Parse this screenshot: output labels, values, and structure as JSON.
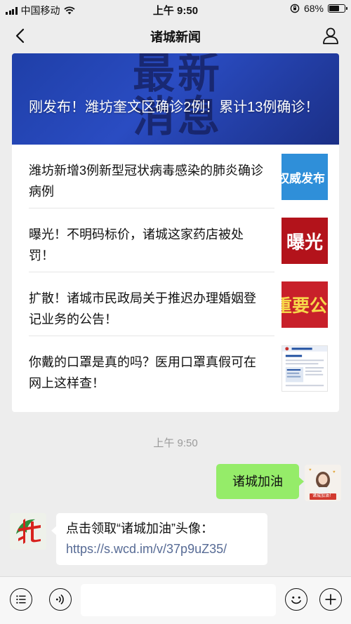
{
  "status_bar": {
    "carrier": "中国移动",
    "time": "上午 9:50",
    "battery_text": "68%",
    "battery_level": 0.68
  },
  "nav": {
    "title": "诸城新闻",
    "back_icon": "chevron-left-icon",
    "profile_icon": "person-icon"
  },
  "article_card": {
    "hero": {
      "title": "刚发布！潍坊奎文区确诊2例！累计13例确诊！",
      "background_text": "最新消息"
    },
    "items": [
      {
        "title": "潍坊新增3例新型冠状病毒感染的肺炎确诊病例",
        "thumb_text": "权威发布",
        "thumb_bg": "#2f8fd9",
        "thumb_color": "#ffffff"
      },
      {
        "title": "曝光！不明码标价，诸城这家药店被处罚！",
        "thumb_text": "曝光",
        "thumb_bg": "#b3131b",
        "thumb_color": "#ffffff"
      },
      {
        "title": "扩散！诸城市民政局关于推迟办理婚姻登记业务的公告！",
        "thumb_text": "重要公",
        "thumb_bg": "#c8202a",
        "thumb_color": "#f7d84a"
      },
      {
        "title": "你戴的口罩是真的吗？医用口罩真假可在网上这样查！",
        "thumb_text": "",
        "thumb_bg": "#ffffff",
        "thumb_color": "#1f4fa0"
      }
    ]
  },
  "chat": {
    "timestamp": "上午 9:50",
    "sent_message": "诸城加油",
    "sent_avatar_caption": "诸城加油！",
    "received_line1": "点击领取“诸城加油”头像：",
    "received_link": "https://s.wcd.im/v/37p9uZ35/"
  },
  "input_bar": {
    "menu_icon": "menu-list-icon",
    "voice_icon": "voice-icon",
    "emoji_icon": "emoji-icon",
    "plus_icon": "plus-icon",
    "input_value": ""
  }
}
